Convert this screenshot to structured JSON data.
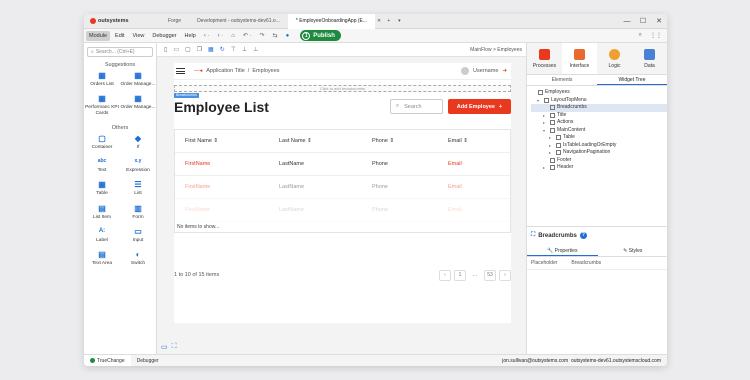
{
  "titlebar": {
    "logo": "outsystems",
    "tabs": [
      "Forge",
      "Development - outsystems-dev61.o...",
      "* EmployeeOnboardingApp (E..."
    ],
    "add_tab": "+",
    "dropdown": "▾",
    "controls": {
      "min": "—",
      "max": "☐",
      "close": "✕"
    }
  },
  "menubar": {
    "items": [
      "Module",
      "Edit",
      "View",
      "Debugger",
      "Help"
    ],
    "publish": {
      "count": "1",
      "label": "Publish"
    }
  },
  "left": {
    "search_placeholder": "Search... (Ctrl+E)",
    "suggestions_title": "Suggestions",
    "suggestions": [
      {
        "label": "Orders List",
        "icon": "▦"
      },
      {
        "label": "Order Manage...",
        "icon": "▦"
      },
      {
        "label": "Performanc KPI Cards",
        "icon": "▦"
      },
      {
        "label": "Order Manage...",
        "icon": "▦"
      }
    ],
    "others_title": "Others",
    "others": [
      {
        "label": "Container",
        "icon": "▢"
      },
      {
        "label": "If",
        "icon": "◆"
      },
      {
        "label": "Text",
        "icon": "abc"
      },
      {
        "label": "Expression",
        "icon": "x.y"
      },
      {
        "label": "Table",
        "icon": "▦"
      },
      {
        "label": "List",
        "icon": "☰"
      },
      {
        "label": "List Item",
        "icon": "▤"
      },
      {
        "label": "Form",
        "icon": "▥"
      },
      {
        "label": "Label",
        "icon": "A:"
      },
      {
        "label": "Input",
        "icon": "▭"
      },
      {
        "label": "Text Area",
        "icon": "▤"
      },
      {
        "label": "Switch",
        "icon": "◐"
      }
    ]
  },
  "canvas": {
    "breadcrumb": "MainFlow > Employees",
    "app_title": "Application Title",
    "app_sep": "/",
    "app_page": "Employees",
    "username": "Username",
    "bc_placeholder": "Click to add breadcrumbs",
    "bc_tag": "Breadcrumbs",
    "title": "Employee List",
    "search_placeholder": "Search",
    "add_button": "Add Employee",
    "add_plus": "+",
    "columns": [
      "First Name",
      "Last Name",
      "Phone",
      "Email"
    ],
    "sort_glyph": "⇕",
    "rows": [
      {
        "first": "FirstName",
        "last": "LastName",
        "phone": "Phone",
        "email": "Email"
      },
      {
        "first": "FirstName",
        "last": "LastName",
        "phone": "Phone",
        "email": "Email"
      },
      {
        "first": "FirstName",
        "last": "LastName",
        "phone": "Phone",
        "email": "Email"
      }
    ],
    "no_items": "No items to show...",
    "pagination_text": "1 to 10 of 15 items",
    "pages": [
      "‹",
      "1",
      "...",
      "53",
      "›"
    ]
  },
  "right": {
    "tabs": [
      {
        "label": "Processes",
        "color": "#e8391e"
      },
      {
        "label": "Interface",
        "color": "#e86a2e"
      },
      {
        "label": "Logic",
        "color": "#f0a030"
      },
      {
        "label": "Data",
        "color": "#4a7fd6"
      }
    ],
    "subtabs": [
      "Elements",
      "Widget Tree"
    ],
    "tree": [
      {
        "label": "Employees",
        "level": 0,
        "arrow": ""
      },
      {
        "label": "LayoutTopMenu",
        "level": 1,
        "arrow": "▾"
      },
      {
        "label": "Breadcrumbs",
        "level": 2,
        "arrow": "",
        "sel": true
      },
      {
        "label": "Title",
        "level": 2,
        "arrow": "▸"
      },
      {
        "label": "Actions",
        "level": 2,
        "arrow": "▸"
      },
      {
        "label": "MainContent",
        "level": 2,
        "arrow": "▾"
      },
      {
        "label": "Table",
        "level": 3,
        "arrow": "▸"
      },
      {
        "label": "IsTableLoadingOrEmpty",
        "level": 3,
        "arrow": "▸"
      },
      {
        "label": "NavigationPagination",
        "level": 3,
        "arrow": "▸"
      },
      {
        "label": "Footer",
        "level": 2,
        "arrow": ""
      },
      {
        "label": "Header",
        "level": 2,
        "arrow": "▸"
      }
    ],
    "selected_name": "Breadcrumbs",
    "qm": "?",
    "prop_tabs": [
      "Properties",
      "Styles"
    ],
    "prop_key": "Placeholder",
    "prop_val": "Breadcrumbs"
  },
  "status": {
    "tabs": [
      "TrueChange",
      "Debugger"
    ],
    "user": "jon.sullivan@outsystems.com",
    "server": "outsystems-dev61.outsystemscloud.com"
  },
  "colors": {
    "accent": "#e8391e",
    "publish": "#1e8a3e",
    "link": "#1f6fd6"
  }
}
